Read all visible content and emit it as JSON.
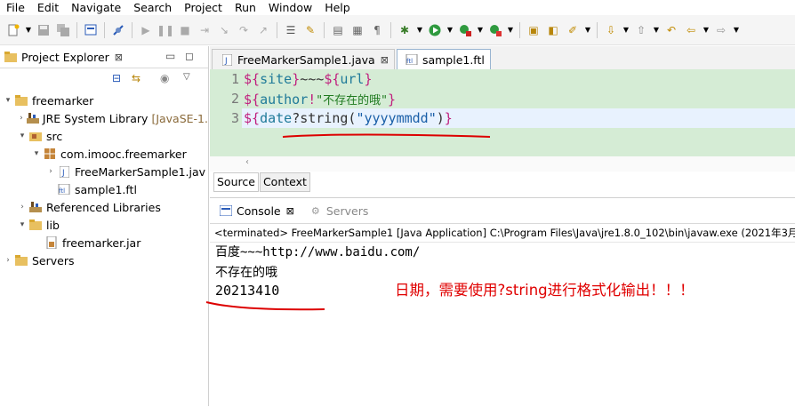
{
  "menu": [
    "File",
    "Edit",
    "Navigate",
    "Search",
    "Project",
    "Run",
    "Window",
    "Help"
  ],
  "explorer": {
    "title": "Project Explorer",
    "close": "⊠",
    "tree": {
      "project": "freemarker",
      "jre": "JRE System Library",
      "jre_version": "[JavaSE-1.",
      "src": "src",
      "package": "com.imooc.freemarker",
      "java_file": "FreeMarkerSample1.jav",
      "ftl_file": "sample1.ftl",
      "ref_libs": "Referenced Libraries",
      "lib": "lib",
      "jar": "freemarker.jar",
      "servers": "Servers"
    }
  },
  "editor": {
    "tabs": [
      {
        "label": "FreeMarkerSample1.java",
        "close": "⊠"
      },
      {
        "label": "sample1.ftl"
      }
    ],
    "line_numbers": [
      "1",
      "2",
      "3"
    ],
    "lines": [
      {
        "p1": "${",
        "v1": "site",
        "p2": "}",
        "t1": "~~~",
        "p3": "${",
        "v2": "url",
        "p4": "}"
      },
      {
        "p1": "${",
        "v1": "author",
        "p2": "!",
        "s1": "\"不存在的哦\"",
        "p3": "}"
      },
      {
        "p1": "${",
        "v1": "date",
        "t1": "?string(",
        "s1": "\"yyyymmdd\"",
        "t2": ")",
        "p2": "}"
      }
    ],
    "subtabs": [
      "Source",
      "Context"
    ]
  },
  "console": {
    "tab": "Console",
    "close": "⊠",
    "servers_tab": "Servers",
    "status": "<terminated> FreeMarkerSample1 [Java Application] C:\\Program Files\\Java\\jre1.8.0_102\\bin\\javaw.exe (2021年3月",
    "output": [
      "百度~~~http://www.baidu.com/",
      "不存在的哦",
      "20213410"
    ],
    "annotation": "日期，需要使用?string进行格式化输出！！！"
  },
  "colors": {
    "annotation": "#e00000",
    "code_bg": "#d5ecd5",
    "directive": "#c01f7e",
    "variable": "#1f7a99",
    "string": "#1a5fa8"
  }
}
